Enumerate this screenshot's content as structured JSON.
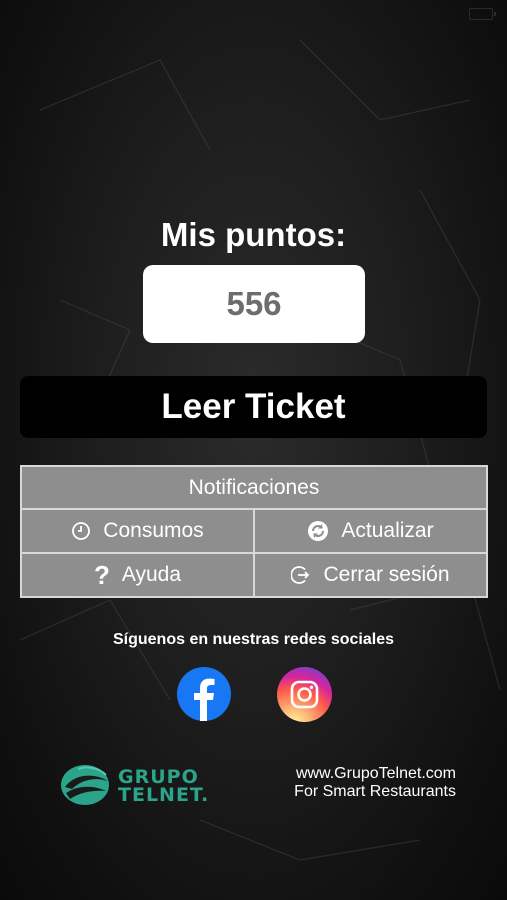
{
  "status_bar": {
    "time": ""
  },
  "points": {
    "title": "Mis puntos:",
    "value": "556"
  },
  "read_ticket": {
    "label": "Leer Ticket"
  },
  "menu": {
    "notifications": "Notificaciones",
    "consumption": "Consumos",
    "refresh": "Actualizar",
    "help": "Ayuda",
    "logout": "Cerrar sesión"
  },
  "social": {
    "follow_text": "Síguenos en nuestras redes sociales",
    "facebook_icon": "facebook-icon",
    "instagram_icon": "instagram-icon"
  },
  "footer": {
    "logo_line1": "GRUPO",
    "logo_line2": "TELNET.",
    "url": "www.GrupoTelnet.com",
    "tagline": "For Smart Restaurants"
  },
  "colors": {
    "menu_cell": "#8e8e8e",
    "menu_border": "#d8d8d8",
    "points_value": "#6d6d6d",
    "brand_green": "#2aa58b",
    "facebook_blue": "#1877f2"
  }
}
